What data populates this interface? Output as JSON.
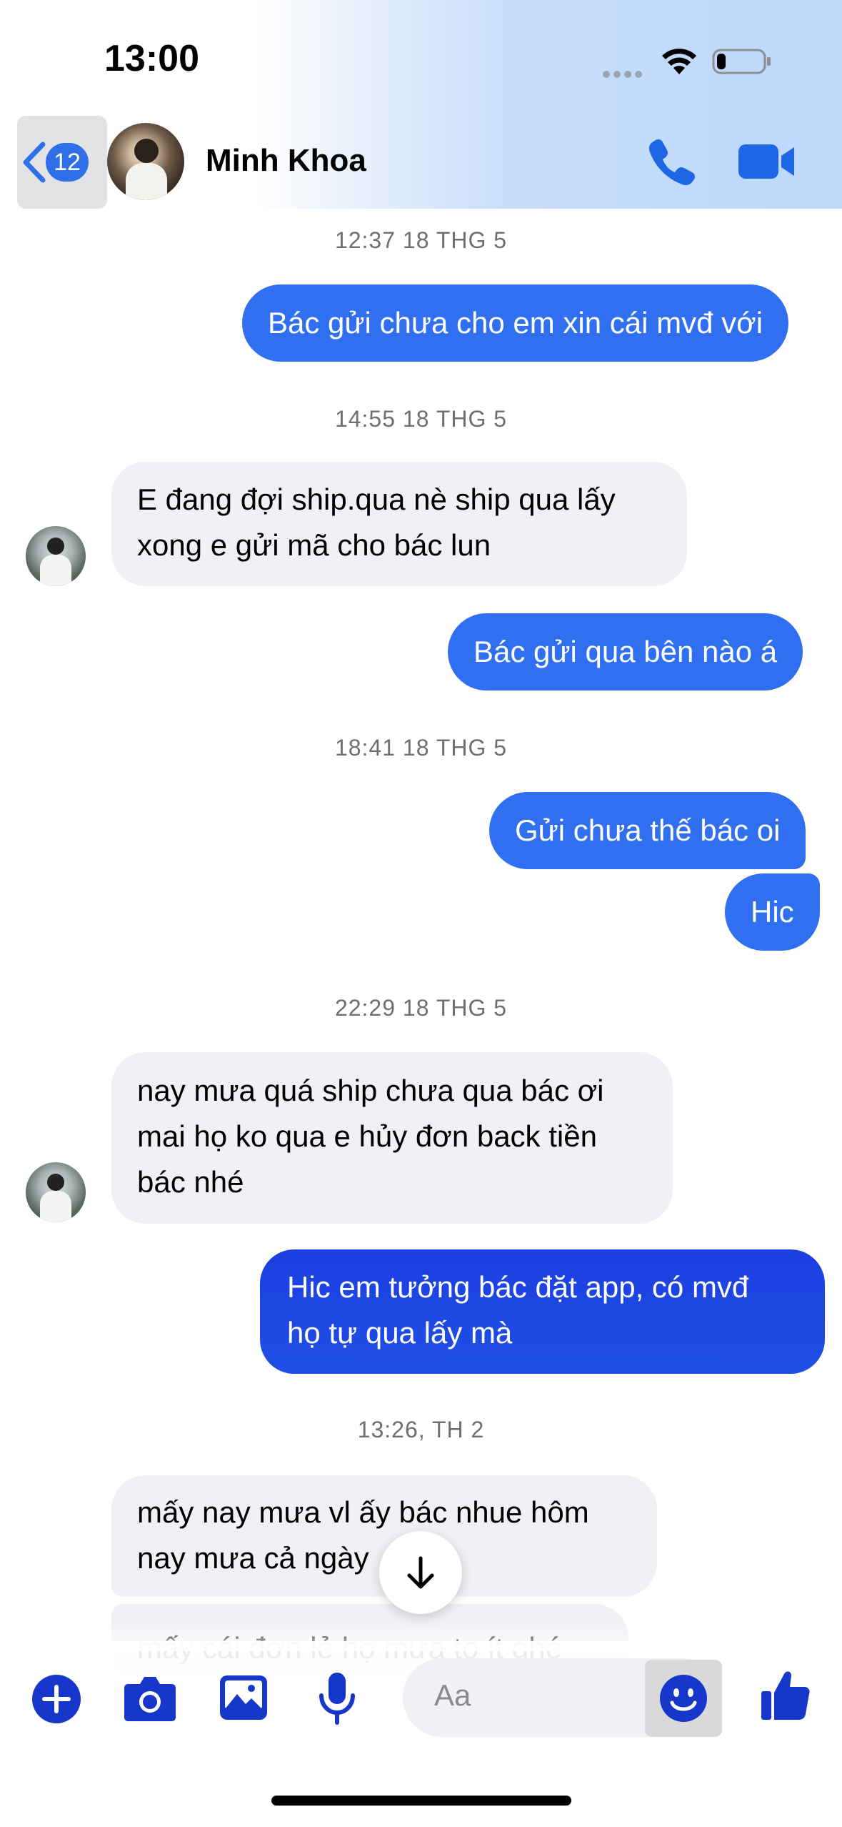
{
  "status_bar": {
    "time": "13:00"
  },
  "header": {
    "back_badge": "12",
    "contact_name": "Minh Khoa"
  },
  "messages": [
    {
      "type": "timestamp",
      "text": "12:37 18 THG 5"
    },
    {
      "type": "outgoing",
      "text": "Bác gửi chưa cho em xin cái mvđ với"
    },
    {
      "type": "timestamp",
      "text": "14:55 18 THG 5"
    },
    {
      "type": "incoming",
      "lines": [
        "E đang đợi ship.qua nè ship qua lấy",
        "xong e gửi mã cho bác lun"
      ]
    },
    {
      "type": "outgoing",
      "text": "Bác gửi qua bên nào á"
    },
    {
      "type": "timestamp",
      "text": "18:41 18 THG 5"
    },
    {
      "type": "outgoing",
      "text": "Gửi chưa thế bác oi"
    },
    {
      "type": "outgoing",
      "text": "Hic"
    },
    {
      "type": "timestamp",
      "text": "22:29 18 THG 5"
    },
    {
      "type": "incoming",
      "lines": [
        "nay mưa quá ship chưa qua bác ơi",
        "mai họ ko qua e hủy đơn back tiền",
        "bác nhé"
      ]
    },
    {
      "type": "outgoing",
      "lines": [
        "Hic em tưởng bác đặt app, có mvđ",
        "họ tự qua lấy mà"
      ]
    },
    {
      "type": "timestamp",
      "text": "13:26, TH 2"
    },
    {
      "type": "incoming",
      "lines": [
        "mấy nay mưa vl ấy bác nhue hôm",
        "nay mưa cả ngày"
      ]
    },
    {
      "type": "incoming",
      "text": "mấy cái đơn lẻ họ mưa to ít ghé"
    }
  ],
  "composer": {
    "placeholder": "Aa"
  },
  "icons": {
    "back": "chevron-left-icon",
    "call": "phone-icon",
    "video": "video-camera-icon",
    "plus": "plus-circle-icon",
    "camera": "camera-icon",
    "gallery": "image-icon",
    "mic": "microphone-icon",
    "emoji": "smiley-icon",
    "like": "thumbs-up-icon",
    "scroll": "arrow-down-icon"
  },
  "colors": {
    "accent": "#2f6ff0",
    "icon_blue": "#1637c9",
    "incoming_bg": "#f0f1f5"
  }
}
